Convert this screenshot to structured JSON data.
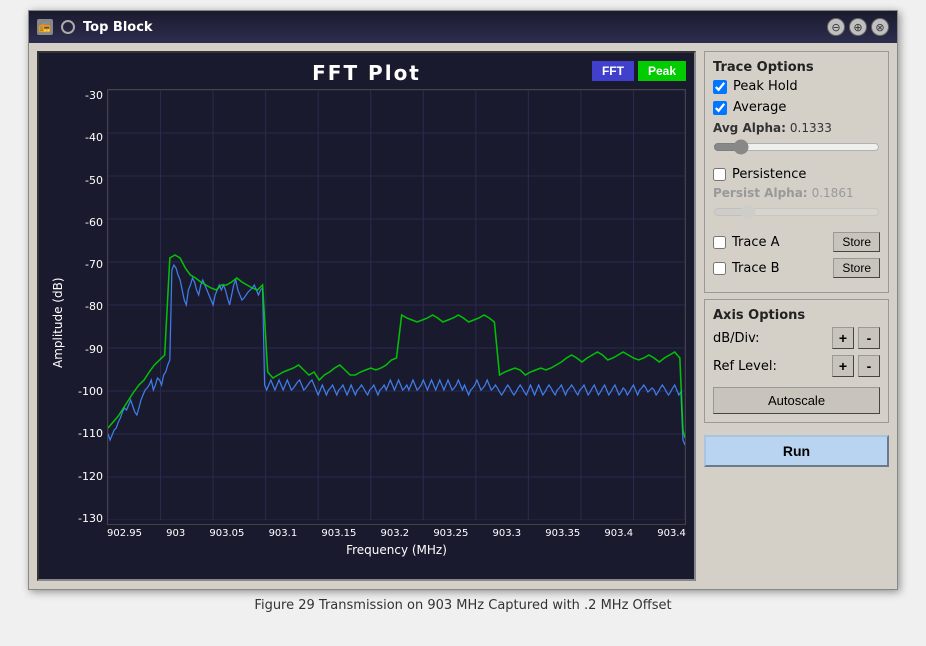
{
  "window": {
    "title": "Top Block",
    "icon": "🔊"
  },
  "titlebar": {
    "buttons": [
      "⊖",
      "⊕",
      "⊗"
    ]
  },
  "plot": {
    "title": "FFT  Plot",
    "fft_btn_label": "FFT",
    "peak_btn_label": "Peak",
    "y_label": "Amplitude (dB)",
    "x_label": "Frequency (MHz)",
    "y_ticks": [
      "-30",
      "-40",
      "-50",
      "-60",
      "-70",
      "-80",
      "-90",
      "-100",
      "-110",
      "-120",
      "-130"
    ],
    "x_ticks": [
      "902.95",
      "903",
      "903.05",
      "903.1",
      "903.15",
      "903.2",
      "903.25",
      "903.3",
      "903.35",
      "903.4",
      "903.4"
    ]
  },
  "trace_options": {
    "header": "Trace  Options",
    "peak_hold_label": "Peak Hold",
    "peak_hold_checked": true,
    "average_label": "Average",
    "average_checked": true,
    "avg_alpha_label": "Avg Alpha:",
    "avg_alpha_value": "0.1333",
    "avg_alpha_slider": 13,
    "persistence_label": "Persistence",
    "persistence_checked": false,
    "persist_alpha_label": "Persist Alpha:",
    "persist_alpha_value": "0.1861",
    "persist_alpha_slider": 18,
    "trace_a_label": "Trace A",
    "trace_b_label": "Trace B",
    "store_label": "Store"
  },
  "axis_options": {
    "header": "Axis Options",
    "db_div_label": "dB/Div:",
    "ref_level_label": "Ref Level:",
    "plus_label": "+",
    "minus_label": "-"
  },
  "buttons": {
    "autoscale": "Autoscale",
    "run": "Run"
  },
  "caption": "Figure 29 Transmission on 903 MHz Captured with .2 MHz Offset"
}
